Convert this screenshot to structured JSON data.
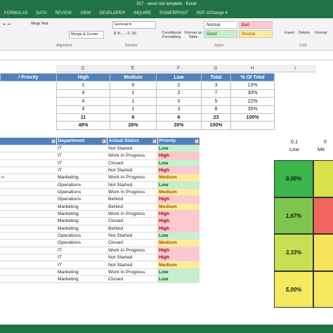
{
  "window_title": "017 - excel risk template - Excel",
  "menu": [
    "FORMULAS",
    "DATA",
    "REVIEW",
    "VIEW",
    "DEVELOPER",
    "INQUIRE",
    "POWERPIVOT",
    "PDF-XChange 4"
  ],
  "ribbon": {
    "wrap_text": "Wrap Text",
    "merge_center": "Merge & Center",
    "number_format": "General",
    "conditional_formatting": "Conditional Formatting",
    "format_as_table": "Format as Table",
    "style_normal": "Normal",
    "style_bad": "Bad",
    "style_good": "Good",
    "style_neutral": "Neutral",
    "insert": "Insert",
    "delete": "Delete",
    "format": "Format",
    "group_alignment": "Alignment",
    "group_number": "Number",
    "group_styles": "Styles",
    "group_cells": "Cells"
  },
  "columns": [
    "D",
    "E",
    "F",
    "G",
    "H",
    "I"
  ],
  "summary": {
    "header": [
      "/ Priority",
      "High",
      "Medium",
      "Low",
      "Total",
      "% Of Total"
    ],
    "rows": [
      [
        "",
        "1",
        "0",
        "2",
        "3",
        "13%"
      ],
      [
        "",
        "4",
        "1",
        "2",
        "7",
        "30%"
      ],
      [
        "",
        "4",
        "1",
        "0",
        "5",
        "22%"
      ],
      [
        "",
        "4",
        "1",
        "3",
        "8",
        "35%"
      ],
      [
        "",
        "11",
        "6",
        "6",
        "23",
        "100%"
      ],
      [
        "",
        "48%",
        "26%",
        "26%",
        "100%",
        ""
      ]
    ]
  },
  "tasks": {
    "header": [
      "",
      "Department",
      "Actual Status",
      "Priority"
    ],
    "rows": [
      [
        "",
        "IT",
        "Not Started",
        "Low"
      ],
      [
        "",
        "IT",
        "Work In Progress",
        "High"
      ],
      [
        "",
        "IT",
        "Closed",
        "Low"
      ],
      [
        "",
        "IT",
        "Not Started",
        "High"
      ],
      [
        "n",
        "Marketing",
        "Work In Progress",
        "Medium"
      ],
      [
        "",
        "Operations",
        "Not Started",
        "Low"
      ],
      [
        "",
        "Operations",
        "Work In Progress",
        "Medium"
      ],
      [
        "",
        "Operations",
        "Behind",
        "High"
      ],
      [
        "",
        "Marketing",
        "Behind",
        "Medium"
      ],
      [
        "",
        "Marketing",
        "Work In Progress",
        "High"
      ],
      [
        "",
        "Marketing",
        "Closed",
        "High"
      ],
      [
        "",
        "Marketing",
        "Behind",
        "High"
      ],
      [
        "",
        "Operations",
        "Not Started",
        "Low"
      ],
      [
        "",
        "Operations",
        "Closed",
        "Medium"
      ],
      [
        "",
        "IT",
        "Work In Progress",
        "High"
      ],
      [
        "",
        "IT",
        "Not Started",
        "High"
      ],
      [
        "",
        "IT",
        "Not Started",
        "Medium"
      ],
      [
        "",
        "Marketing",
        "Work In Progress",
        "Low"
      ],
      [
        "",
        "Marketing",
        "Closed",
        "Low"
      ]
    ]
  },
  "matrix": {
    "col_values": [
      "0,1",
      "0"
    ],
    "col_labels": [
      "Low",
      "Me"
    ],
    "rows": [
      {
        "value": "0,00%",
        "color": "#3cb54a",
        "next_color": "#d8e24a"
      },
      {
        "value": "1,67%",
        "color": "#7ec64e",
        "next_color": "#f0665e"
      },
      {
        "value": "3,33%",
        "color": "#c9df52",
        "next_color": "#f6e55a"
      },
      {
        "value": "5,00%",
        "color": "#f3ea5e",
        "next_color": "#f5e85e"
      }
    ]
  },
  "colors": {
    "accent": "#217346",
    "header_blue": "#4f81bd"
  }
}
